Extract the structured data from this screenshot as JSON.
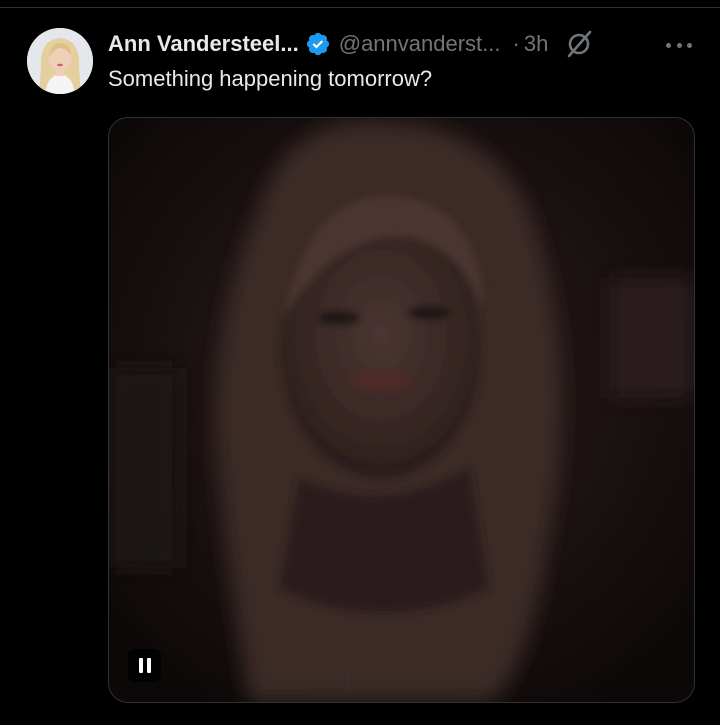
{
  "tweet": {
    "author": {
      "display_name": "Ann Vandersteel...",
      "handle": "@annvanderst...",
      "verified": true,
      "avatar_icon": "user-avatar"
    },
    "separator": "·",
    "timestamp": "3h",
    "text": "Something happening tomorrow?",
    "media": {
      "type": "video",
      "state": "playing",
      "control_icon": "pause-icon"
    }
  },
  "colors": {
    "background": "#000000",
    "primary_text": "#e7e9ea",
    "secondary_text": "#71767b",
    "verified_badge": "#1d9bf0",
    "divider": "#2f3336"
  }
}
